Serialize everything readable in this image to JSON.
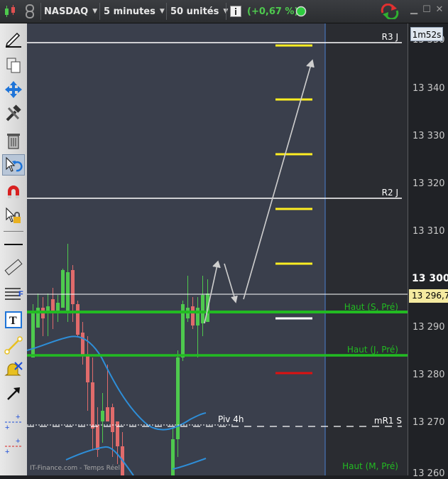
{
  "toolbar_top": {
    "symbol": "NASDAQ",
    "interval": "5 minutes",
    "units": "50 unités",
    "change": "(+0,67 %)",
    "change_color": "#4ec94e",
    "status_color": "#2ecc40"
  },
  "chart": {
    "timer": "1m52s",
    "current_price": "13 296,7",
    "bold_price": "13 300",
    "watermark": "IT-Finance.com - Temps Réel",
    "axis_ticks": [
      "13 350",
      "13 340",
      "13 330",
      "13 320",
      "13 310",
      "13 290",
      "13 280",
      "13 270"
    ],
    "bottom_tick": "13 260",
    "levels": [
      {
        "label": "R3 J",
        "color": "#ffffff"
      },
      {
        "label": "R2 J",
        "color": "#ffffff"
      },
      {
        "label": "Haut (S, Pré)",
        "color": "#22bb22"
      },
      {
        "label": "Haut (J, Pré)",
        "color": "#22bb22"
      },
      {
        "label": "mR1 S",
        "color": "#ffffff"
      },
      {
        "label": "Piv 4h",
        "color": "#ffffff"
      },
      {
        "label": "Haut (M, Pré)",
        "color": "#22bb22"
      }
    ],
    "colors": {
      "background": "#3a3f4c",
      "future_zone": "#2a2c31",
      "bull": "#4ec94e",
      "bear": "#e06b6b",
      "moving_average": "#2e8ed8",
      "target_yellow": "#ffee22",
      "target_red": "#dd1111",
      "target_white": "#ffffff",
      "arrow": "#cfcfcf",
      "time_cursor": "#4a7fd0"
    }
  },
  "tools": [
    "pencil-icon",
    "copy-icon",
    "move-arrows-icon",
    "wrench-hammer-icon",
    "trash-icon",
    "undo-cursor-icon",
    "magnet-icon",
    "lock-cursor-icon",
    "horizontal-line-icon",
    "ruler-icon",
    "fibonacci-icon",
    "text-icon",
    "trendline-icon",
    "alert-bell-icon",
    "arrow-icon",
    "blue-cross-icon",
    "red-cross-icon"
  ]
}
